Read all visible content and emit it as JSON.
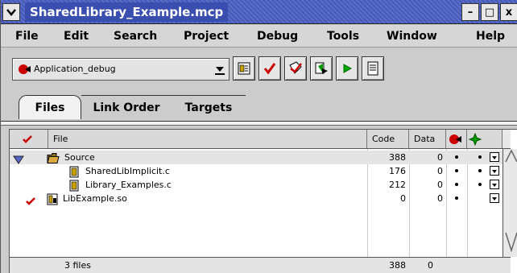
{
  "window": {
    "title": "SharedLibrary_Example.mcp",
    "minimize_glyph": "–",
    "maximize_glyph": "□",
    "close_glyph": "x"
  },
  "menus": [
    "File",
    "Edit",
    "Search",
    "Project",
    "Debug",
    "Tools",
    "Window",
    "Help"
  ],
  "toolbar": {
    "target_value": "Application_debug",
    "buttons": [
      "settings-icon",
      "check-syntax-icon",
      "bring-up-to-date-icon",
      "make-icon",
      "run-icon",
      "document-icon"
    ]
  },
  "tabs": [
    "Files",
    "Link Order",
    "Targets"
  ],
  "table": {
    "headers": {
      "file": "File",
      "code": "Code",
      "data": "Data"
    },
    "rows": [
      {
        "name": "Source",
        "code": "388",
        "data": "0",
        "type": "group"
      },
      {
        "name": "SharedLibImplicit.c",
        "code": "176",
        "data": "0",
        "type": "file"
      },
      {
        "name": "Library_Examples.c",
        "code": "212",
        "data": "0",
        "type": "file"
      },
      {
        "name": "LibExample.so",
        "code": "0",
        "data": "0",
        "type": "lib"
      }
    ],
    "footer": {
      "count": "3 files",
      "code": "388",
      "data": "0"
    }
  },
  "colors": {
    "title_bar": "#4458b8",
    "title_text_bg": "#3a4eb0",
    "accent_red": "#cc0000",
    "accent_green": "#009900"
  }
}
